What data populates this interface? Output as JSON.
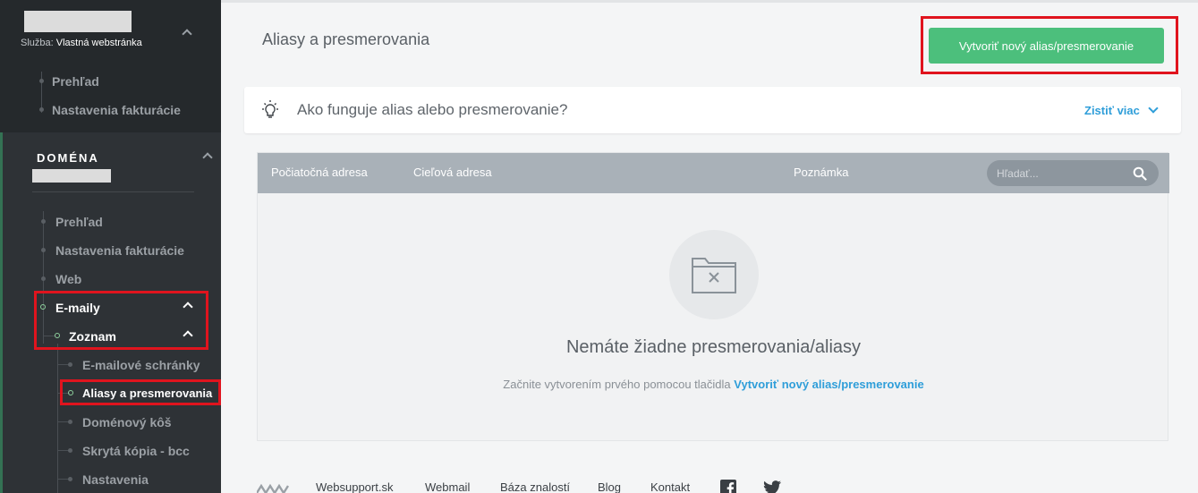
{
  "sidebar": {
    "service_label": "Služba:",
    "service_value": "Vlastná webstránka",
    "account_items": [
      "Prehľad",
      "Nastavenia fakturácie"
    ],
    "domain_title": "DOMÉNA",
    "domain_items": [
      "Prehľad",
      "Nastavenia fakturácie",
      "Web"
    ],
    "emails_label": "E-maily",
    "list_label": "Zoznam",
    "email_subitems": [
      "E-mailové schránky",
      "Aliasy a presmerovania",
      "Doménový kôš",
      "Skrytá kópia - bcc",
      "Nastavenia"
    ]
  },
  "main": {
    "title": "Aliasy a presmerovania",
    "create_button": "Vytvoriť nový alias/presmerovanie",
    "info": {
      "text": "Ako funguje alias alebo presmerovanie?",
      "link": "Zistiť viac"
    },
    "table": {
      "columns": [
        "Počiatočná adresa",
        "Cieľová adresa",
        "Poznámka"
      ],
      "search_placeholder": "Hľadať..."
    },
    "empty": {
      "title": "Nemáte žiadne presmerovania/aliasy",
      "subtitle": "Začnite vytvorením prvého pomocou tlačidla",
      "subtitle_link": "Vytvoriť nový alias/presmerovanie"
    }
  },
  "footer": {
    "links": [
      "Websupport.sk",
      "Webmail",
      "Báza znalostí",
      "Blog",
      "Kontakt"
    ]
  },
  "colors": {
    "sidebar_bg": "#2e3236",
    "primary_green": "#4cbf7c",
    "link_blue": "#2f9ed9",
    "table_header": "#a9b1b8",
    "highlight_red": "#e0141e"
  },
  "icons": [
    "lightbulb-icon",
    "chevron-down-icon",
    "search-icon",
    "empty-folder-icon",
    "facebook-icon",
    "twitter-icon"
  ]
}
